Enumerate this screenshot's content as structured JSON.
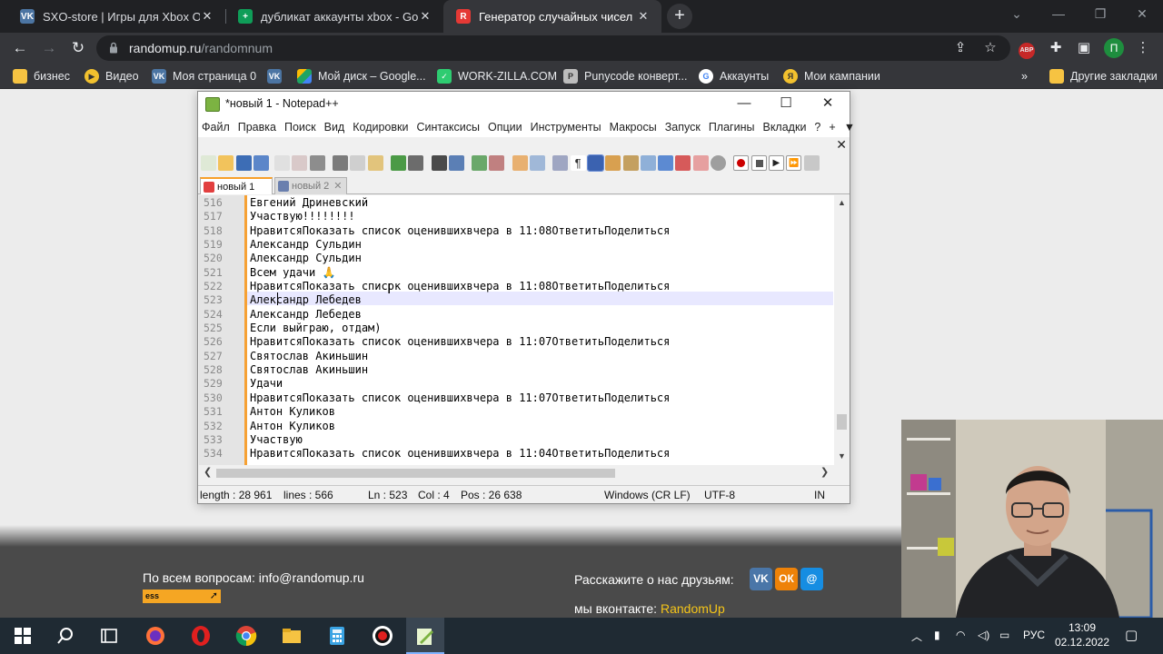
{
  "browser": {
    "tabs": [
      {
        "title": "SXO-store | Игры для Xbox One",
        "icon": "vk-icon",
        "color": "#4c75a3"
      },
      {
        "title": "дубликат аккаунты xbox - Goog",
        "icon": "sheets-icon",
        "color": "#0f9d58"
      },
      {
        "title": "Генератор случайных чисел",
        "icon": "randomup-icon",
        "color": "#e53935"
      }
    ],
    "url_host": "randomup.ru",
    "url_path": "/randomnum",
    "profile_letter": "П",
    "bookmarks": [
      {
        "label": "бизнес",
        "icon": "folder-icon",
        "color": "#f6c342"
      },
      {
        "label": "Видео",
        "icon": "play-icon",
        "color": "#f2c12e"
      },
      {
        "label": "Моя страница 0",
        "icon": "vk-icon",
        "color": "#4c75a3"
      },
      {
        "label": "",
        "icon": "vk-icon",
        "color": "#4c75a3"
      },
      {
        "label": "Мой диск – Google...",
        "icon": "drive-icon",
        "color": "#1fa463"
      },
      {
        "label": "WORK-ZILLA.COM",
        "icon": "check-icon",
        "color": "#2ecc71"
      },
      {
        "label": "Punycode конверт...",
        "icon": "puny-icon",
        "color": "#cccccc"
      },
      {
        "label": "Аккаунты",
        "icon": "google-icon",
        "color": "#ffffff"
      },
      {
        "label": "Мои кампании",
        "icon": "yandex-icon",
        "color": "#f2c12e"
      }
    ],
    "other_bookmarks": "Другие закладки"
  },
  "notepad": {
    "title": "*новый 1 - Notepad++",
    "menu": [
      "Файл",
      "Правка",
      "Поиск",
      "Вид",
      "Кодировки",
      "Синтаксисы",
      "Опции",
      "Инструменты",
      "Макросы",
      "Запуск",
      "Плагины",
      "Вкладки",
      "?",
      "+",
      "▼"
    ],
    "tabs": [
      {
        "label": "новый 1",
        "active": true
      },
      {
        "label": "новый 2",
        "active": false
      }
    ],
    "lines": [
      {
        "n": "516",
        "t": "Евгений Дриневский"
      },
      {
        "n": "517",
        "t": "Участвую!!!!!!!!"
      },
      {
        "n": "518",
        "t": "НравитсяПоказать список оценившихвчера в 11:08ОтветитьПоделиться"
      },
      {
        "n": "519",
        "t": "Александр Сульдин"
      },
      {
        "n": "520",
        "t": "Александр Сульдин"
      },
      {
        "n": "521",
        "t": "Всем удачи 🙏"
      },
      {
        "n": "522",
        "t": "НравитсяПоказать список оценившихвчера в 11:08ОтветитьПоделиться"
      },
      {
        "n": "523",
        "t": "Александр Лебедев"
      },
      {
        "n": "524",
        "t": "Александр Лебедев"
      },
      {
        "n": "525",
        "t": "Если выйграю, отдам)"
      },
      {
        "n": "526",
        "t": "НравитсяПоказать список оценившихвчера в 11:07ОтветитьПоделиться"
      },
      {
        "n": "527",
        "t": "Святослав Акиньшин"
      },
      {
        "n": "528",
        "t": "Святослав Акиньшин"
      },
      {
        "n": "529",
        "t": "Удачи"
      },
      {
        "n": "530",
        "t": "НравитсяПоказать список оценившихвчера в 11:07ОтветитьПоделиться"
      },
      {
        "n": "531",
        "t": "Антон Куликов"
      },
      {
        "n": "532",
        "t": "Антон Куликов"
      },
      {
        "n": "533",
        "t": "Участвую"
      },
      {
        "n": "534",
        "t": "НравитсяПоказать список оценившихвчера в 11:04ОтветитьПоделиться"
      }
    ],
    "status": {
      "length": "length : 28 961",
      "lines": "lines : 566",
      "ln": "Ln : 523",
      "col": "Col : 4",
      "pos": "Pos : 26 638",
      "eol": "Windows (CR LF)",
      "encoding": "UTF-8",
      "mode": "IN"
    }
  },
  "site_footer": {
    "contact_prefix": "По всем вопросам:",
    "contact_email": "info@randomup.ru",
    "ess_label": "ess",
    "share_text": "Расскажите о нас друзьям:",
    "vk_prefix": "мы вконтакте:",
    "vk_link": "RandomUp",
    "accent": "#f5a623",
    "link_color": "#f5c518"
  },
  "taskbar": {
    "lang": "РУС",
    "time": "13:09",
    "date": "02.12.2022"
  }
}
